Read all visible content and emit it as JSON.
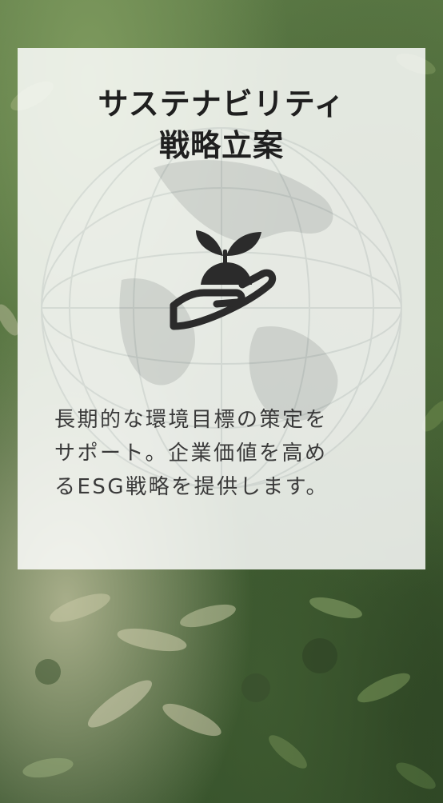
{
  "card": {
    "title_lines": [
      "サステナビリティ",
      "戦略立案"
    ],
    "icon": "hand-holding-sprout-icon",
    "description_lines": [
      "長期的な環境目標の策定を",
      "サポート。企業価値を高め",
      "るESG戦略を提供します。"
    ]
  },
  "colors": {
    "title": "#1f1f1f",
    "text": "#3a3a3a",
    "icon": "#2b2b2b",
    "card_overlay": "rgba(255,255,255,0.84)",
    "foliage": "#4a6838"
  }
}
